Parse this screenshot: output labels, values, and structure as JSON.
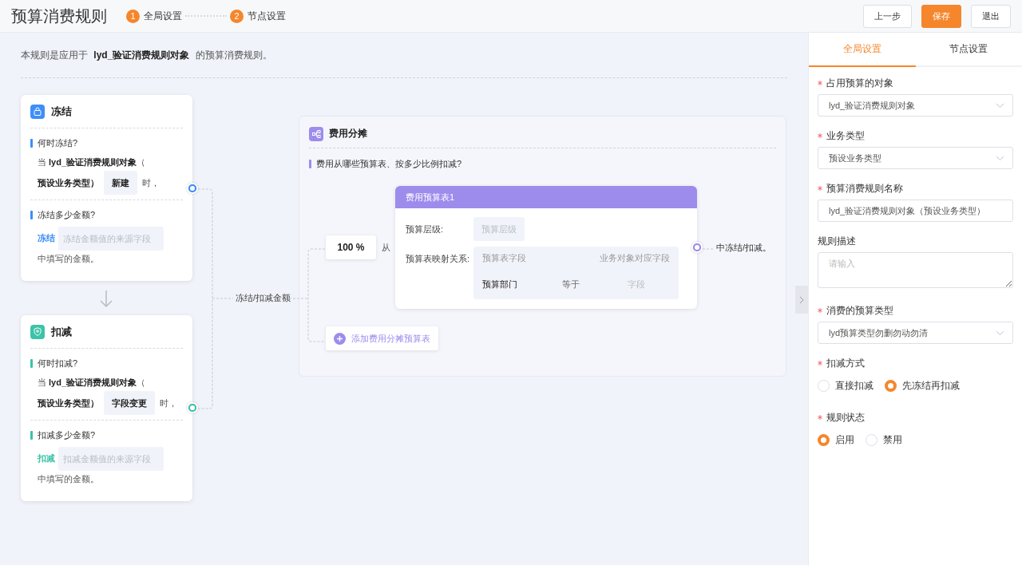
{
  "header": {
    "title": "预算消费规则",
    "steps": [
      {
        "number": "1",
        "label": "全局设置"
      },
      {
        "number": "2",
        "label": "节点设置"
      }
    ],
    "buttons": [
      {
        "label": "上一步",
        "kind": "default"
      },
      {
        "label": "保存",
        "kind": "primary"
      },
      {
        "label": "退出",
        "kind": "default"
      }
    ]
  },
  "canvas": {
    "intro": "本规则是应用于 **lyd_验证消费规则对象** 的预算消费规则。",
    "nodes": [
      {
        "kind": "freeze",
        "title": "冻结",
        "color": "#3d8ef8",
        "when_question": "何时冻结?",
        "condition_line1": "当 **lyd_验证消费规则对象**（",
        "condition_line2": "预设业务类型）",
        "event": "新建",
        "condition_end": "时，",
        "amount_question": "冻结多少金额?",
        "action": "冻结",
        "source_placeholder": "冻结金额值的来源字段",
        "amount_end": "中填写的金额。"
      },
      {
        "kind": "deduct",
        "title": "扣减",
        "color": "#3cc3a8",
        "when_question": "何时扣减?",
        "condition_line1": "当 **lyd_验证消费规则对象**（",
        "condition_line2": "预设业务类型）",
        "event": "字段变更",
        "condition_end": "时，",
        "amount_question": "扣减多少金额?",
        "action": "扣减",
        "source_placeholder": "扣减金额值的来源字段",
        "amount_end": "中填写的金额。"
      }
    ],
    "amount_label": "冻结/扣减金额",
    "allocation": {
      "title": "费用分摊",
      "question": "费用从哪些预算表、按多少比例扣减?",
      "ratio": "100 %",
      "from": "从",
      "table": {
        "title": "费用预算表1",
        "level_label": "预算层级:",
        "level_placeholder": "预算层级",
        "mapping_label": "预算表映射关系:",
        "mapping_headers": [
          "预算表字段",
          "业务对象对应字段"
        ],
        "mappings": [
          {
            "field": "预算部门",
            "operator": "等于",
            "placeholder": "字段"
          }
        ]
      },
      "suffix": "中冻结/扣减。",
      "add_button": "添加费用分摊预算表"
    }
  },
  "side_panel": {
    "tabs": [
      {
        "label": "全局设置",
        "selected": true
      },
      {
        "label": "节点设置",
        "selected": false
      }
    ],
    "fields": [
      {
        "kind": "select",
        "label": "占用预算的对象",
        "required": true,
        "value": "lyd_验证消费规则对象"
      },
      {
        "kind": "select",
        "label": "业务类型",
        "required": true,
        "value": "预设业务类型"
      },
      {
        "kind": "input",
        "label": "预算消费规则名称",
        "required": true,
        "value": "lyd_验证消费规则对象（预设业务类型）"
      },
      {
        "kind": "textarea",
        "label": "规则描述",
        "required": false,
        "placeholder": "请输入"
      },
      {
        "kind": "select",
        "label": "消费的预算类型",
        "required": true,
        "value": "lyd预算类型勿删勿动勿清"
      },
      {
        "kind": "radio",
        "label": "扣减方式",
        "required": true,
        "options": [
          {
            "label": "直接扣减",
            "selected": false
          },
          {
            "label": "先冻结再扣减",
            "selected": true
          }
        ]
      },
      {
        "kind": "radio",
        "label": "规则状态",
        "required": true,
        "options": [
          {
            "label": "启用",
            "selected": true
          },
          {
            "label": "禁用",
            "selected": false
          }
        ]
      }
    ]
  }
}
